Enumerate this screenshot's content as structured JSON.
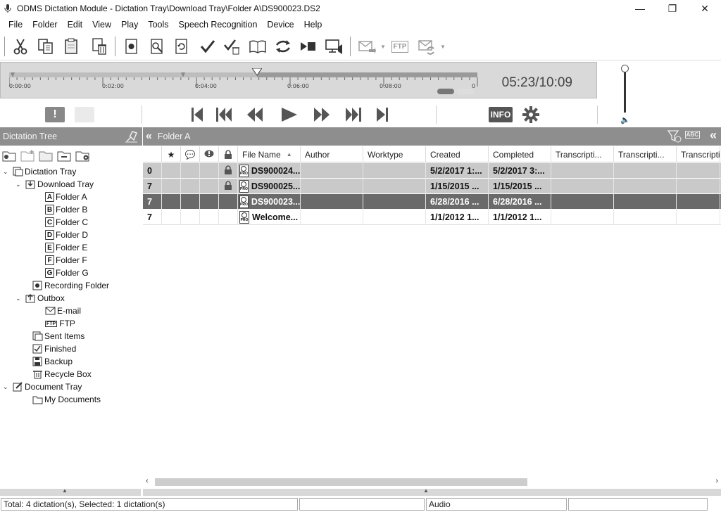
{
  "window": {
    "title": "ODMS Dictation Module - Dictation Tray\\Download Tray\\Folder A\\DS900023.DS2",
    "minimize": "—",
    "maximize": "❐",
    "close": "✕"
  },
  "menu": [
    "File",
    "Folder",
    "Edit",
    "View",
    "Play",
    "Tools",
    "Speech Recognition",
    "Device",
    "Help"
  ],
  "toolbar": {
    "icons": [
      "cut-icon",
      "copy-icon",
      "paste-icon",
      "delete-icon",
      "record-icon",
      "dictation-properties-icon",
      "reload-icon",
      "finish-icon",
      "finish-all-icon",
      "book-icon",
      "sync-icon",
      "play-stop-icon",
      "display-icon",
      "email-send-icon",
      "ftp-icon",
      "email-receive-icon"
    ],
    "ftp_label": "FTP"
  },
  "timeline": {
    "labels": [
      "0:00:00",
      "0:02:00",
      "0:04:00",
      "0:06:00",
      "0:08:00",
      "0"
    ],
    "current_time": "05:23/10:09",
    "progress": 0.53
  },
  "controls": {
    "priority_label": "!",
    "info_label": "INFO"
  },
  "left_panel": {
    "title": "Dictation Tree",
    "tree": [
      {
        "label": "Dictation Tray"
      },
      {
        "label": "Download Tray"
      },
      {
        "label": "Folder A",
        "letter": "A"
      },
      {
        "label": "Folder B",
        "letter": "B"
      },
      {
        "label": "Folder C",
        "letter": "C"
      },
      {
        "label": "Folder D",
        "letter": "D"
      },
      {
        "label": "Folder E",
        "letter": "E"
      },
      {
        "label": "Folder F",
        "letter": "F"
      },
      {
        "label": "Folder G",
        "letter": "G"
      },
      {
        "label": "Recording Folder"
      },
      {
        "label": "Outbox"
      },
      {
        "label": "E-mail"
      },
      {
        "label": "FTP",
        "badge": "FTP"
      },
      {
        "label": "Sent Items"
      },
      {
        "label": "Finished"
      },
      {
        "label": "Backup"
      },
      {
        "label": "Recycle Box"
      },
      {
        "label": "Document Tray"
      },
      {
        "label": "My Documents"
      }
    ]
  },
  "right_panel": {
    "title": "Folder A",
    "abc_label": "ABC",
    "columns": [
      "",
      "",
      "",
      "",
      "",
      "File Name",
      "Author",
      "Worktype",
      "Created",
      "Completed",
      "Transcripti...",
      "Transcripti...",
      "Transcripti"
    ],
    "rows": [
      {
        "priority": "0",
        "locked": true,
        "file": "DS900024...",
        "created": "5/2/2017 1:...",
        "completed": "5/2/2017 3:...",
        "state": "gray"
      },
      {
        "priority": "7",
        "locked": true,
        "file": "DS900025...",
        "created": "1/15/2015 ...",
        "completed": "1/15/2015 ...",
        "state": "gray"
      },
      {
        "priority": "7",
        "locked": false,
        "file": "DS900023...",
        "created": "6/28/2016 ...",
        "completed": "6/28/2016 ...",
        "state": "selected"
      },
      {
        "priority": "7",
        "locked": false,
        "file": "Welcome...",
        "created": "1/1/2012 1...",
        "completed": "1/1/2012 1...",
        "state": "white"
      }
    ],
    "pro_badge": "PRO"
  },
  "statusbar": {
    "summary": "Total: 4 dictation(s), Selected: 1 dictation(s)",
    "field2": "",
    "type": "Audio",
    "field4": ""
  }
}
